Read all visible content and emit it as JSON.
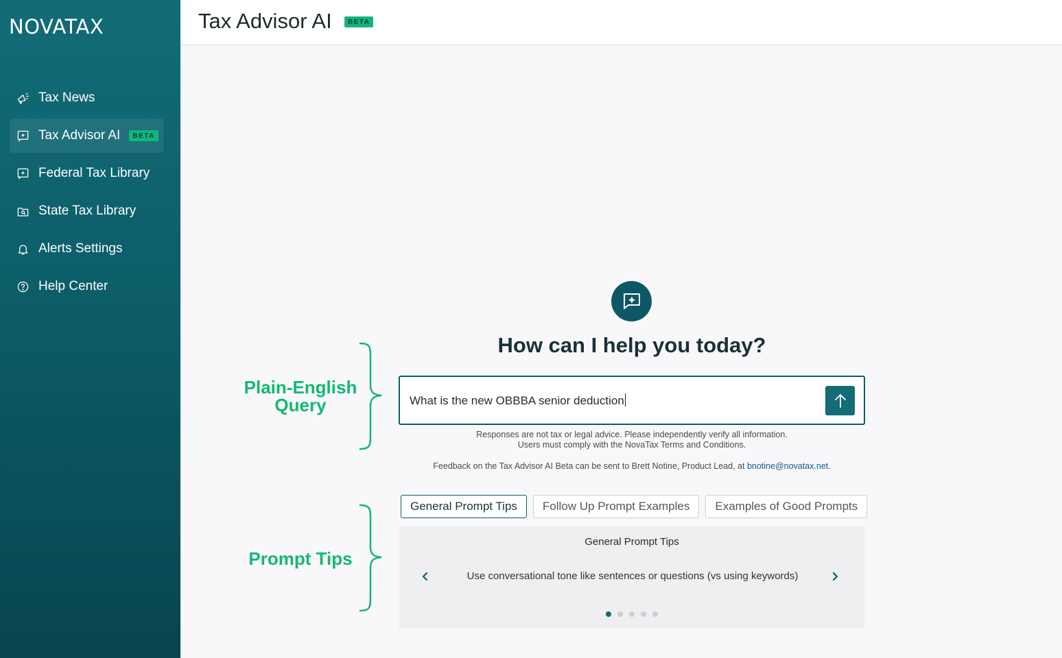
{
  "app": {
    "logo": "NOVATAX"
  },
  "sidebar": {
    "items": [
      {
        "label": "Tax News",
        "icon": "megaphone-icon"
      },
      {
        "label": "Tax Advisor AI",
        "icon": "chat-sparkle-icon",
        "badge": "BETA",
        "active": true
      },
      {
        "label": "Federal Tax Library",
        "icon": "chat-sparkle-icon"
      },
      {
        "label": "State Tax Library",
        "icon": "folder-search-icon"
      },
      {
        "label": "Alerts Settings",
        "icon": "bell-icon"
      },
      {
        "label": "Help Center",
        "icon": "help-circle-icon"
      }
    ]
  },
  "header": {
    "title": "Tax Advisor AI",
    "badge": "BETA"
  },
  "main": {
    "greeting": "How can I help you today?",
    "query": {
      "value": "What is the new OBBBA senior deduction",
      "send_icon": "arrow-up-icon"
    },
    "disclaimer_line1": "Responses are not tax or legal advice. Please independently verify all information.",
    "disclaimer_line2": "Users must comply with the NovaTax Terms and Conditions.",
    "feedback_text": "Feedback on the Tax Advisor AI Beta can be sent to Brett Notine, Product Lead, at ",
    "feedback_email": "bnotine@novatax.net",
    "feedback_end": ".",
    "tabs": [
      {
        "label": "General Prompt Tips",
        "active": true
      },
      {
        "label": "Follow Up Prompt Examples",
        "active": false
      },
      {
        "label": "Examples of Good Prompts",
        "active": false
      }
    ],
    "tips": {
      "title": "General Prompt Tips",
      "text": "Use conversational tone like sentences or questions (vs using keywords)",
      "dot_count": 5,
      "active_dot": 1
    }
  },
  "annotations": {
    "query_label": "Plain-English Query",
    "tips_label": "Prompt Tips"
  },
  "colors": {
    "sidebar": "#0c5d68",
    "accent": "#136c76",
    "beta_badge": "#11b779",
    "annotation": "#14b873"
  }
}
